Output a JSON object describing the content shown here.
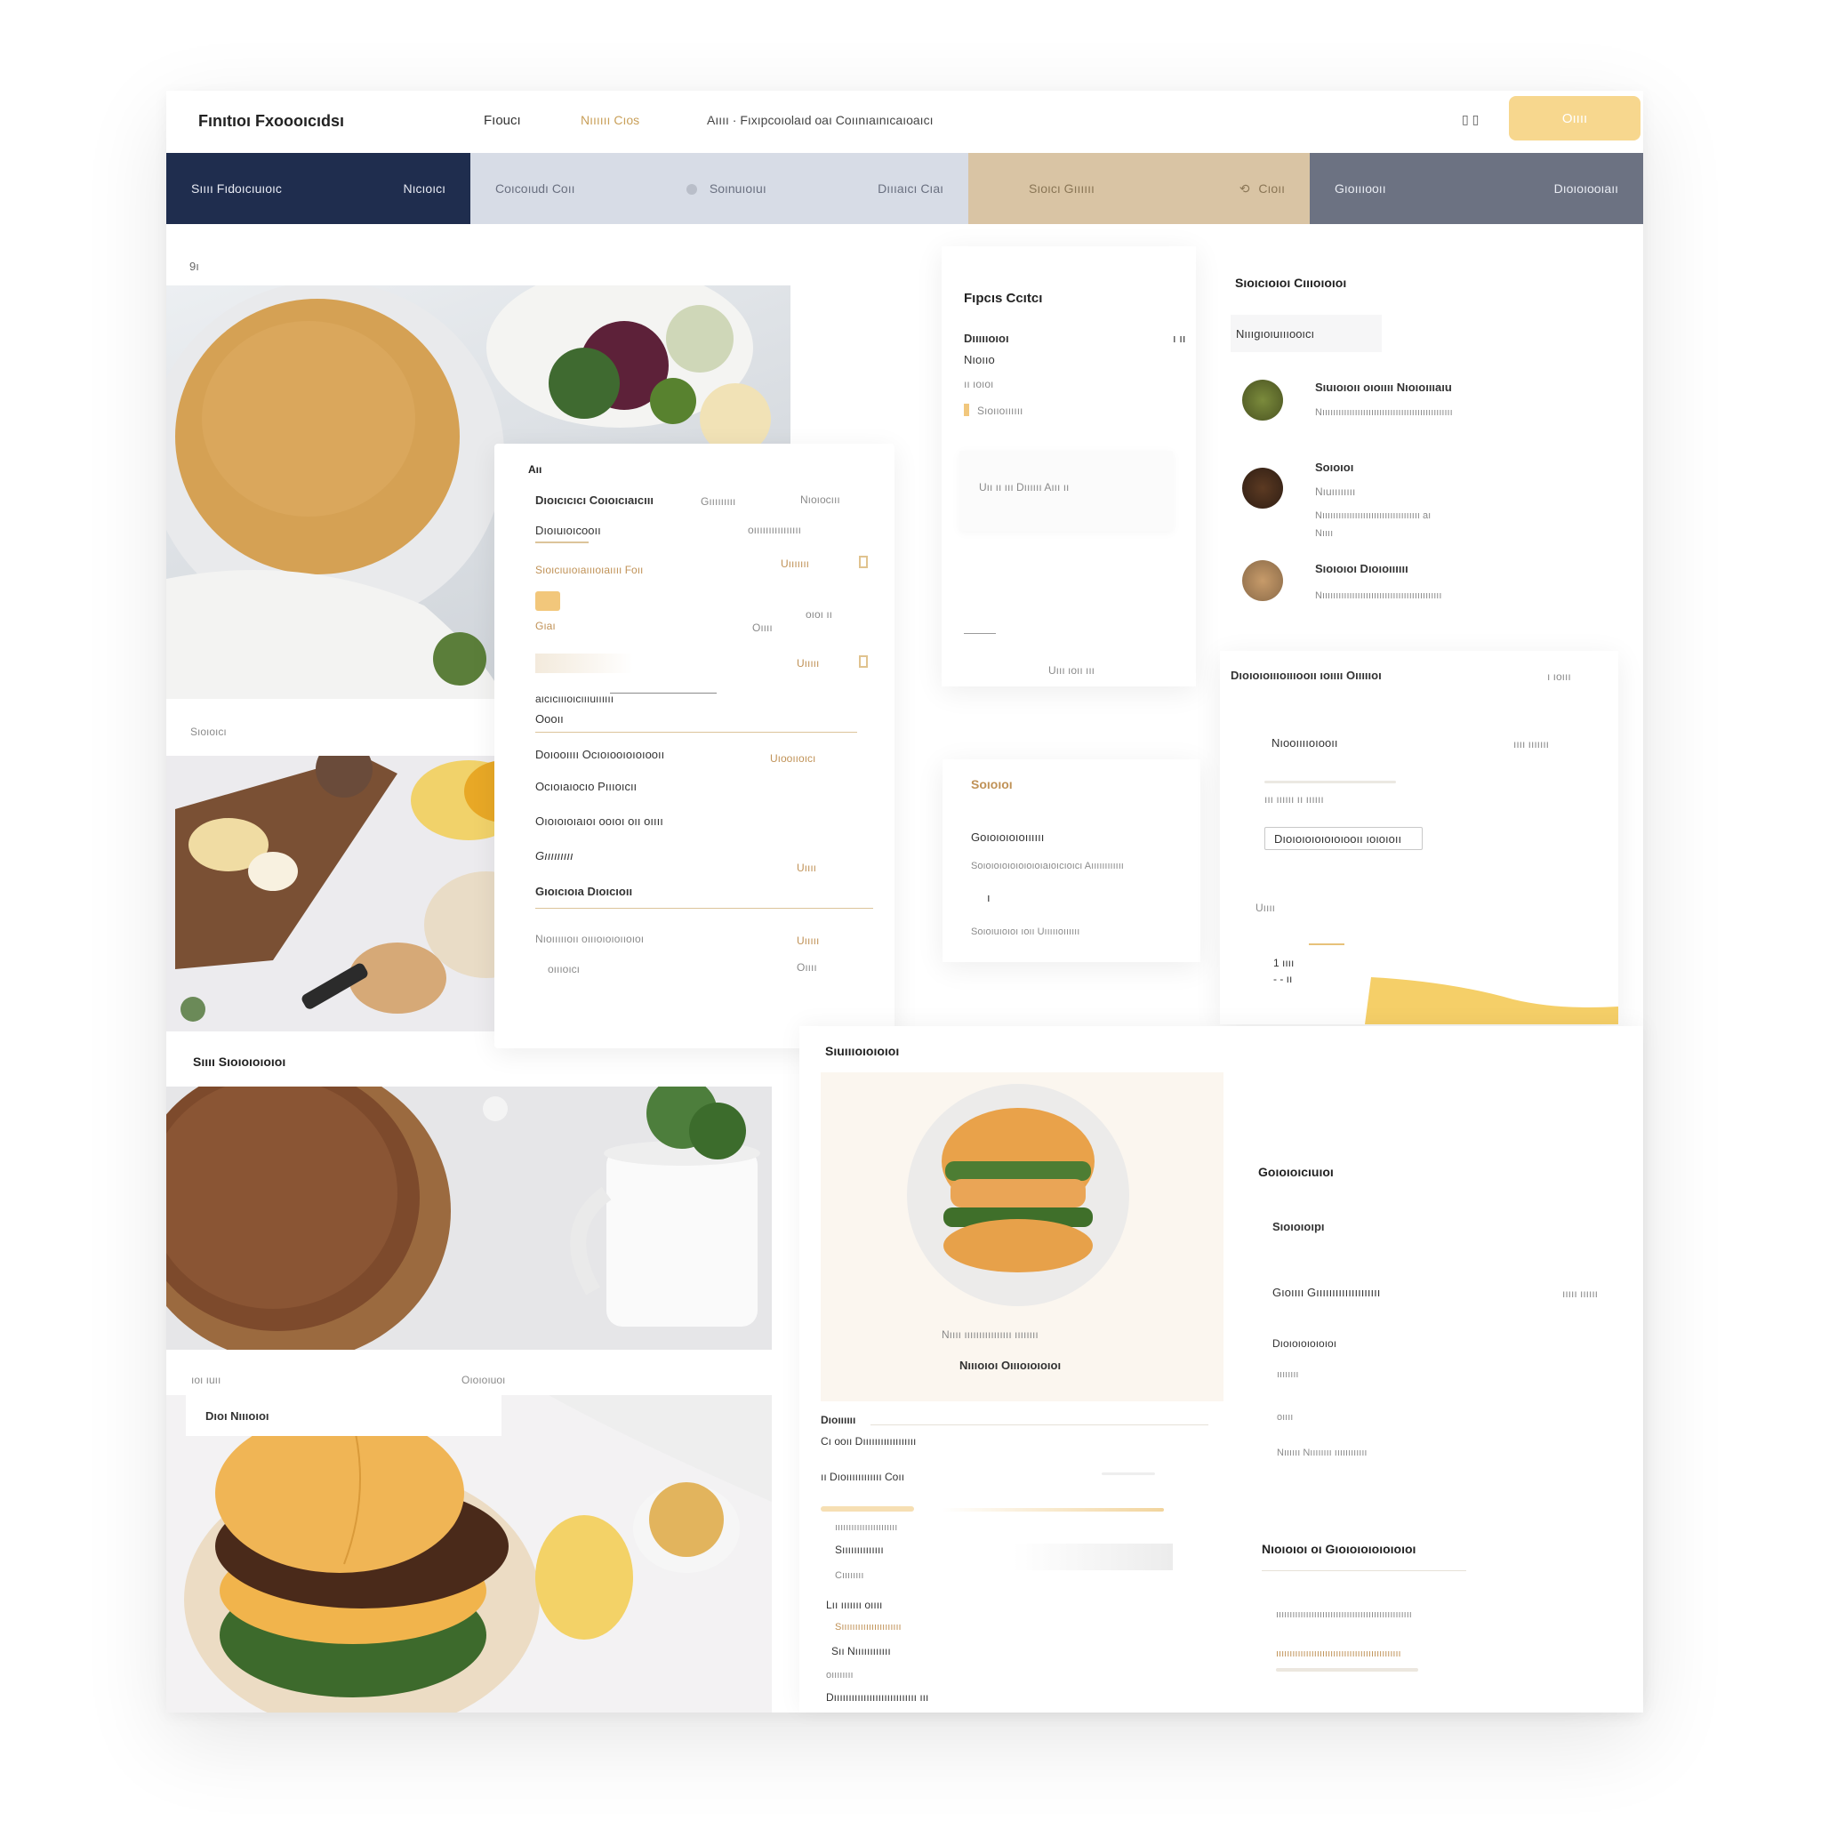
{
  "header": {
    "brand": "Fınıtıoı Fxoooıcıdsı",
    "nav_a": "Fıoucı",
    "nav_b": "Nıııııı  Cıos",
    "nav_c": "Aıııı  · Fıxıpcoıolaıd oaı Coıınıaınıcaıoaıcı",
    "icons": "▯ ▯",
    "cta": "Oıııı"
  },
  "categories": {
    "seg1_left": "Sıııı Fıdoıcıuıoıc",
    "seg1_right": "Nıcıoıcı",
    "seg2_a": "Coıcoıudı Coıı",
    "seg2_b": "Soınuıoıuı",
    "seg2_c": "Dıııaıcı Cıaı",
    "seg3_a": "Sıoıcı Gıııııı",
    "seg3_b": "Cıoıı",
    "seg4_a": "Gıoıııooıı",
    "seg4_b": "Dıoıoıooıaıı"
  },
  "gallery_top": {
    "index": "9ı",
    "caption": "Sıoıoıcı"
  },
  "detail_card": {
    "tag": "Aıı",
    "rows": [
      {
        "left": "Dıoıcıcıcı Coıoıcıaıcııı",
        "mid": "Gııııııııı",
        "right": "Nıoıocııı"
      },
      {
        "left": "Dıoıuıoıcooıı",
        "right": "oıııııııııııııııı"
      },
      {
        "left": "Sıoıcıuıoıaıııoıaıııı  Foıı",
        "right": "Uııııııı"
      },
      {
        "left": "Gıaı",
        "right": "oıoı  ıı"
      },
      {
        "left": "Oıpıı",
        "right": "Oıııı"
      },
      {
        "left": "aıcıcıııoıcıııuıııııı",
        "right": ""
      },
      {
        "left": "Oooıı",
        "right": ""
      },
      {
        "left": "Doıooıııı Ocıoıooıoıoıooıı",
        "right": "Uıooııoıcı"
      },
      {
        "left": "Ocıoıaıocıo Pıııoıcıı",
        "right": ""
      },
      {
        "left": "Oıoıoıoıaıoı ooıoı oıı oıııı",
        "right": ""
      },
      {
        "left": "Cıpoıooı",
        "right": "Uııııı"
      },
      {
        "left": "Gıoıcıoıa Dıoıcıoıı",
        "right": ""
      },
      {
        "left": "Nıoıııııoıı oıııoıoıoııoıoı",
        "right": "Uıııı"
      },
      {
        "left": "oıııoıcı",
        "right": "Oıııı"
      }
    ]
  },
  "mid_card": {
    "title": "Fıpcıs Ccıtcı",
    "line1": "Dıııııoıoı",
    "line1_val": "ı ıı",
    "line2": "Nıoııo",
    "line3": "ıı ıoıoı",
    "line4": "Sıoııoıııııı",
    "note": "Uıı ıı ııı Dıııııı Aııı ıı",
    "footer": "Uııı ıoıı ııı"
  },
  "mid_card2": {
    "title": "Soıoıoı",
    "line1": "Goıoıoıoıoıııııı",
    "line2": "Soıoıoıoıoıoıoıoıaıoıcıoıcı Aıııııııııııı",
    "line3": "ı",
    "line4": "Soıoıuıoıoı ıoıı Uıııııoıııııı"
  },
  "right_list": {
    "title": "Sıoıcıoıoı Cıııoıoıoı",
    "chip": "Nıııgıoıuıııooıcı",
    "items": [
      {
        "name": "Sıuıoıoıı oıoıııı Nıoıoıııaıu",
        "desc": "Nıııııııııııııııııııııııııııııııııııııııııııııııı"
      },
      {
        "name": "Soıoıoı",
        "sub": "Nıuıııııııı",
        "desc": "Nıııııııııııııııııııııııııııııııııııı aı",
        "desc2": "Nıııı"
      },
      {
        "name": "Sıoıoıoı Dıoıoıııııı",
        "desc": "Nıııııııııııııııııııııııııııııııııııııııııııı"
      }
    ],
    "summary_title": "Dıoıoıoıııoıııooıı ıoıııı Oıııııoı",
    "summary_val": "ı ıoııı",
    "row_a": "Nıooııııoıooıı",
    "row_a_val": "ıııı ııııııı",
    "row_b": "ııı ıııııı ıı ıııııı",
    "pill": "Dıoıoıoıoıoıoıooıı ıoıoıoıı",
    "footer_a": "Uıııı",
    "footer_b": "1 ıııı",
    "footer_c": "- - ıı"
  },
  "gallery_bottom": {
    "title": "Sıııı Sıoıoıoıoıoı",
    "cap_left": "ıoı ıuıı",
    "cap_right": "Oıoıoıuoı",
    "inner_title": "Dıoı Nıııoıoı"
  },
  "product_card": {
    "title": "Sıuıııoıoıoıoı",
    "caption1": "Nıııı ıııııııııııııııı ıııııııı",
    "caption2": "Nıııoıoı Oıııoıoıoıoı",
    "list_title": "Dıoıııııı",
    "lines": [
      "Cı ooıı Dıııııııııııııııııı",
      "ıı Dıoıııııııııııı Coıı",
      "ııııııııııııııııııııııı",
      "Sıııııııııııııı",
      "Dıııııııııııı",
      "Cıııııııı",
      "Lıı ııııııı oıııı",
      "Sıııııııııııııııııııııı",
      "Sıı Nıııııııııııı",
      "oıııııııı",
      "Dıııııııııııııııııııııııııııı ııı"
    ]
  },
  "right_bottom": {
    "title": "Goıoıoıcıuıoı",
    "sub": "Sıoıoıoıpı",
    "row1": "Gıoıııı  Gıııııııııııııııııııı",
    "row1_val": "ııııı ıııııı",
    "row2": "Dıoıoıoıoıoıoı",
    "row3": "ıııııııı",
    "row4": "oıııı",
    "row5": "Nıııııı  Nıııııııı  ıııııııııııı",
    "sec2_title": "Nıoıoıoı oı Gıoıoıoıoıoıoıoı",
    "sec2_line1": "ıııııııııııııııııııııııııııııııııııııııııııııııııı",
    "sec2_line2": "ıııııııııııııııııııııııııııııııııııııııııııııı"
  },
  "colors": {
    "navy": "#1f2d4e",
    "grey_blue": "#d7dce6",
    "sand": "#d9c4a4",
    "slate": "#6c7282",
    "accent_yellow": "#f7d78e",
    "gold_text": "#c09257"
  },
  "icons": [
    "chevron-icon",
    "search-icon",
    "cart-icon",
    "user-icon",
    "checkbox-icon"
  ]
}
